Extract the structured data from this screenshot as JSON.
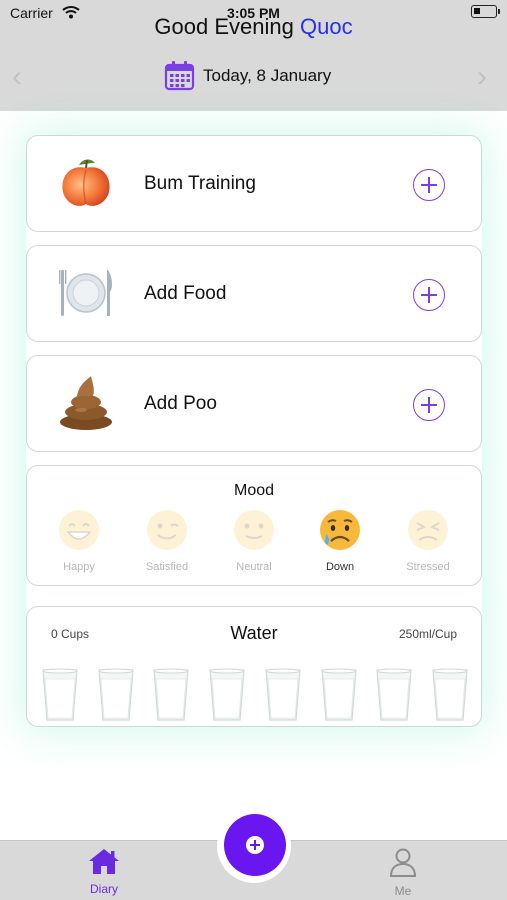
{
  "status_bar": {
    "carrier": "Carrier",
    "time": "3:05 PM"
  },
  "header": {
    "greeting": "Good Evening",
    "user_name": "Quoc",
    "date_label": "Today, 8 January"
  },
  "actions": [
    {
      "label": "Bum Training",
      "icon": "peach-icon"
    },
    {
      "label": "Add Food",
      "icon": "plate-icon"
    },
    {
      "label": "Add Poo",
      "icon": "poo-icon"
    }
  ],
  "mood": {
    "title": "Mood",
    "selected": "Down",
    "options": [
      {
        "label": "Happy",
        "icon": "happy-face-icon"
      },
      {
        "label": "Satisfied",
        "icon": "wink-face-icon"
      },
      {
        "label": "Neutral",
        "icon": "slight-smile-face-icon"
      },
      {
        "label": "Down",
        "icon": "sad-sweat-face-icon"
      },
      {
        "label": "Stressed",
        "icon": "stressed-face-icon"
      }
    ]
  },
  "water": {
    "title": "Water",
    "cups_count_label": "0 Cups",
    "cup_size_label": "250ml/Cup",
    "cups_total": 8
  },
  "tabbar": {
    "tabs": [
      {
        "label": "Diary",
        "icon": "home-icon",
        "active": true
      },
      {
        "label": "Me",
        "icon": "person-icon",
        "active": false
      }
    ],
    "fab_icon": "add-circle-icon"
  },
  "colors": {
    "accent": "#6a16f0",
    "name_blue": "#2a2fe6",
    "header_bg": "#d9d9d9"
  }
}
